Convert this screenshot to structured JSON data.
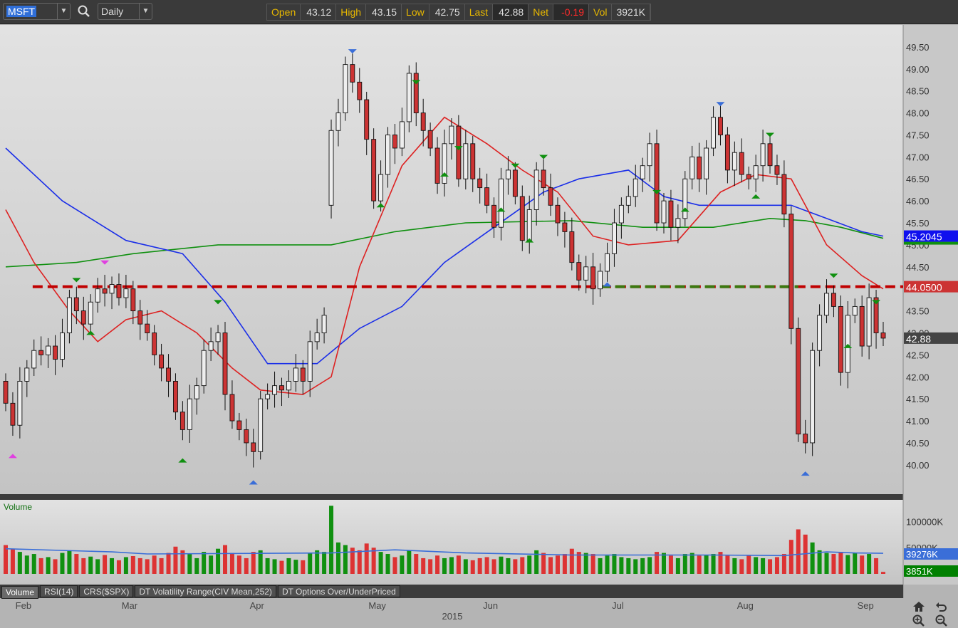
{
  "toolbar": {
    "symbol": "MSFT",
    "interval": "Daily",
    "quote": [
      {
        "label": "Open",
        "value": "43.12"
      },
      {
        "label": "High",
        "value": "43.15"
      },
      {
        "label": "Low",
        "value": "42.75"
      },
      {
        "label": "Last",
        "value": "42.88"
      },
      {
        "label": "Net",
        "value": "-0.19"
      },
      {
        "label": "Vol",
        "value": "3921K"
      }
    ]
  },
  "tabs": [
    "Volume",
    "RSI(14)",
    "CRS($SPX)",
    "DT Volatility Range(CIV Mean,252)",
    "DT Options Over/UnderPriced"
  ],
  "colors": {
    "up": "#eeeeee",
    "down": "#cc3333",
    "ma_short": "#dd2222",
    "ma_mid": "#1a2ee8",
    "ma_long": "#109010",
    "resistance": "#c00000",
    "support": "#3a7a10",
    "vol_up": "#109010",
    "vol_down": "#dd3333",
    "vol_ma": "#3a6ed8"
  },
  "chart_data": {
    "type": "candlestick",
    "symbol": "MSFT",
    "year_label": "2015",
    "price_ticks": [
      "49.50",
      "49.00",
      "48.50",
      "48.00",
      "47.50",
      "47.00",
      "46.50",
      "46.00",
      "45.50",
      "45.00",
      "44.50",
      "44.00",
      "43.50",
      "43.00",
      "42.50",
      "42.00",
      "41.50",
      "41.00",
      "40.50",
      "40.00"
    ],
    "ylim": [
      39.35,
      50.0
    ],
    "months": [
      {
        "label": "Feb",
        "index": 2
      },
      {
        "label": "Mar",
        "index": 17
      },
      {
        "label": "Apr",
        "index": 35
      },
      {
        "label": "May",
        "index": 52
      },
      {
        "label": "Jun",
        "index": 68
      },
      {
        "label": "Jul",
        "index": 86
      },
      {
        "label": "Aug",
        "index": 104
      },
      {
        "label": "Sep",
        "index": 121
      }
    ],
    "close": [
      41.4,
      40.9,
      41.9,
      42.2,
      42.6,
      42.5,
      42.7,
      42.4,
      43.0,
      43.8,
      43.5,
      43.2,
      43.7,
      44.0,
      43.9,
      44.1,
      43.8,
      44.0,
      43.5,
      43.2,
      43.0,
      42.5,
      42.2,
      41.9,
      41.2,
      40.8,
      41.5,
      41.8,
      42.6,
      42.8,
      43.0,
      41.6,
      41.0,
      40.8,
      40.5,
      40.3,
      41.5,
      41.6,
      41.8,
      41.7,
      41.9,
      42.2,
      41.9,
      42.8,
      43.0,
      43.4,
      47.6,
      48.0,
      49.1,
      48.7,
      48.3,
      47.4,
      46.0,
      46.6,
      47.5,
      47.2,
      47.8,
      48.9,
      48.0,
      47.6,
      47.2,
      46.4,
      47.3,
      47.7,
      46.5,
      47.3,
      46.5,
      46.3,
      45.9,
      45.4,
      46.5,
      46.7,
      46.1,
      45.1,
      45.8,
      46.7,
      46.3,
      45.9,
      45.5,
      45.3,
      44.6,
      44.2,
      44.5,
      44.0,
      44.4,
      44.8,
      45.5,
      45.9,
      46.1,
      46.5,
      46.8,
      47.3,
      45.5,
      46.0,
      45.4,
      45.6,
      46.5,
      47.0,
      46.5,
      47.2,
      47.9,
      47.5,
      46.7,
      47.1,
      46.6,
      46.5,
      46.8,
      47.3,
      46.8,
      46.6,
      45.7,
      43.1,
      40.7,
      40.5,
      42.6,
      43.4,
      43.9,
      43.6,
      42.1,
      43.4,
      43.6,
      42.7,
      43.8,
      43.0,
      42.88
    ],
    "first_open": 41.9,
    "gap_open": {
      "46": 45.9
    },
    "moving_averages": [
      {
        "name": "short",
        "color_key": "ma_short",
        "points": [
          [
            0,
            45.8
          ],
          [
            4,
            44.6
          ],
          [
            9,
            43.5
          ],
          [
            13,
            42.8
          ],
          [
            17,
            43.3
          ],
          [
            22,
            43.5
          ],
          [
            27,
            43.0
          ],
          [
            32,
            42.2
          ],
          [
            36,
            41.7
          ],
          [
            42,
            41.6
          ],
          [
            46,
            42.0
          ],
          [
            50,
            44.5
          ],
          [
            56,
            46.8
          ],
          [
            62,
            47.9
          ],
          [
            68,
            47.3
          ],
          [
            73,
            46.7
          ],
          [
            78,
            46.2
          ],
          [
            83,
            45.2
          ],
          [
            88,
            45.0
          ],
          [
            95,
            45.1
          ],
          [
            101,
            46.2
          ],
          [
            106,
            46.6
          ],
          [
            111,
            46.5
          ],
          [
            116,
            45.0
          ],
          [
            121,
            44.3
          ],
          [
            124,
            44.0
          ]
        ]
      },
      {
        "name": "mid",
        "color_key": "ma_mid",
        "last_label": "45.2045",
        "points": [
          [
            0,
            47.2
          ],
          [
            8,
            46.0
          ],
          [
            17,
            45.1
          ],
          [
            25,
            44.8
          ],
          [
            31,
            43.7
          ],
          [
            37,
            42.3
          ],
          [
            44,
            42.3
          ],
          [
            50,
            43.1
          ],
          [
            56,
            43.6
          ],
          [
            62,
            44.6
          ],
          [
            69,
            45.4
          ],
          [
            76,
            46.2
          ],
          [
            81,
            46.5
          ],
          [
            88,
            46.7
          ],
          [
            93,
            46.1
          ],
          [
            98,
            45.9
          ],
          [
            106,
            45.9
          ],
          [
            111,
            45.9
          ],
          [
            116,
            45.6
          ],
          [
            121,
            45.3
          ],
          [
            124,
            45.2
          ]
        ]
      },
      {
        "name": "long",
        "color_key": "ma_long",
        "points": [
          [
            0,
            44.5
          ],
          [
            10,
            44.6
          ],
          [
            18,
            44.8
          ],
          [
            30,
            45.0
          ],
          [
            46,
            45.0
          ],
          [
            55,
            45.3
          ],
          [
            65,
            45.5
          ],
          [
            80,
            45.55
          ],
          [
            90,
            45.4
          ],
          [
            100,
            45.4
          ],
          [
            108,
            45.6
          ],
          [
            113,
            45.55
          ],
          [
            118,
            45.4
          ],
          [
            124,
            45.15
          ]
        ]
      }
    ],
    "levels": [
      {
        "name": "resistance",
        "price": 44.05,
        "from": 2,
        "to": 124,
        "label": "44.0500",
        "color_key": "resistance"
      },
      {
        "name": "support",
        "price": 44.05,
        "from": 84,
        "to": 112,
        "color_key": "support"
      }
    ],
    "last_label": "42.88",
    "pivots": [
      {
        "i": 1,
        "t": "low",
        "c": "#e040e0"
      },
      {
        "i": 10,
        "t": "high",
        "c": "#109010"
      },
      {
        "i": 12,
        "t": "low",
        "c": "#109010"
      },
      {
        "i": 14,
        "t": "high",
        "c": "#e040e0"
      },
      {
        "i": 25,
        "t": "low",
        "c": "#109010"
      },
      {
        "i": 30,
        "t": "high",
        "c": "#109010"
      },
      {
        "i": 35,
        "t": "low",
        "c": "#3a6ed8"
      },
      {
        "i": 49,
        "t": "high",
        "c": "#3a6ed8"
      },
      {
        "i": 53,
        "t": "low",
        "c": "#109010"
      },
      {
        "i": 58,
        "t": "high",
        "c": "#109010"
      },
      {
        "i": 62,
        "t": "low",
        "c": "#109010"
      },
      {
        "i": 64,
        "t": "high",
        "c": "#109010"
      },
      {
        "i": 72,
        "t": "high",
        "c": "#109010"
      },
      {
        "i": 70,
        "t": "low",
        "c": "#109010"
      },
      {
        "i": 74,
        "t": "low",
        "c": "#109010"
      },
      {
        "i": 76,
        "t": "high",
        "c": "#109010"
      },
      {
        "i": 85,
        "t": "low",
        "c": "#3a6ed8"
      },
      {
        "i": 92,
        "t": "high",
        "c": "#109010"
      },
      {
        "i": 96,
        "t": "low",
        "c": "#109010"
      },
      {
        "i": 101,
        "t": "high",
        "c": "#3a6ed8"
      },
      {
        "i": 106,
        "t": "low",
        "c": "#109010"
      },
      {
        "i": 108,
        "t": "high",
        "c": "#109010"
      },
      {
        "i": 113,
        "t": "low",
        "c": "#3a6ed8"
      },
      {
        "i": 117,
        "t": "high",
        "c": "#109010"
      },
      {
        "i": 119,
        "t": "low",
        "c": "#109010"
      },
      {
        "i": 123,
        "t": "high",
        "c": "#109010"
      }
    ],
    "volume": {
      "label": "Volume",
      "ticks": [
        {
          "label": "100000K",
          "value": 100000
        },
        {
          "label": "50000K",
          "value": 50000
        }
      ],
      "ma_label": "39276K",
      "last_label": "3851K",
      "ylim": [
        0,
        140000
      ],
      "values": [
        55000,
        48000,
        42000,
        35000,
        38000,
        30000,
        32000,
        28000,
        40000,
        45000,
        38000,
        30000,
        33000,
        28000,
        36000,
        30000,
        26000,
        32000,
        34000,
        30000,
        28000,
        35000,
        30000,
        40000,
        52000,
        45000,
        38000,
        30000,
        42000,
        35000,
        48000,
        55000,
        40000,
        35000,
        30000,
        42000,
        45000,
        30000,
        28000,
        25000,
        30000,
        27000,
        26000,
        40000,
        45000,
        42000,
        130000,
        60000,
        55000,
        50000,
        45000,
        58000,
        50000,
        42000,
        38000,
        32000,
        35000,
        45000,
        38000,
        30000,
        28000,
        35000,
        30000,
        32000,
        35000,
        28000,
        26000,
        30000,
        32000,
        28000,
        33000,
        30000,
        28000,
        32000,
        35000,
        45000,
        40000,
        32000,
        35000,
        38000,
        48000,
        42000,
        40000,
        38000,
        30000,
        35000,
        38000,
        32000,
        30000,
        28000,
        30000,
        32000,
        42000,
        40000,
        35000,
        30000,
        38000,
        40000,
        35000,
        36000,
        38000,
        42000,
        35000,
        30000,
        28000,
        35000,
        32000,
        30000,
        28000,
        32000,
        38000,
        65000,
        85000,
        75000,
        60000,
        45000,
        40000,
        38000,
        42000,
        36000,
        40000,
        35000,
        38000,
        30000,
        3851
      ]
    },
    "vol_ma_points": [
      [
        0,
        48000
      ],
      [
        15,
        42000
      ],
      [
        20,
        38000
      ],
      [
        46,
        40000
      ],
      [
        55,
        46000
      ],
      [
        65,
        40000
      ],
      [
        80,
        36000
      ],
      [
        100,
        36000
      ],
      [
        110,
        35000
      ],
      [
        116,
        42000
      ],
      [
        120,
        40000
      ],
      [
        124,
        39276
      ]
    ]
  }
}
